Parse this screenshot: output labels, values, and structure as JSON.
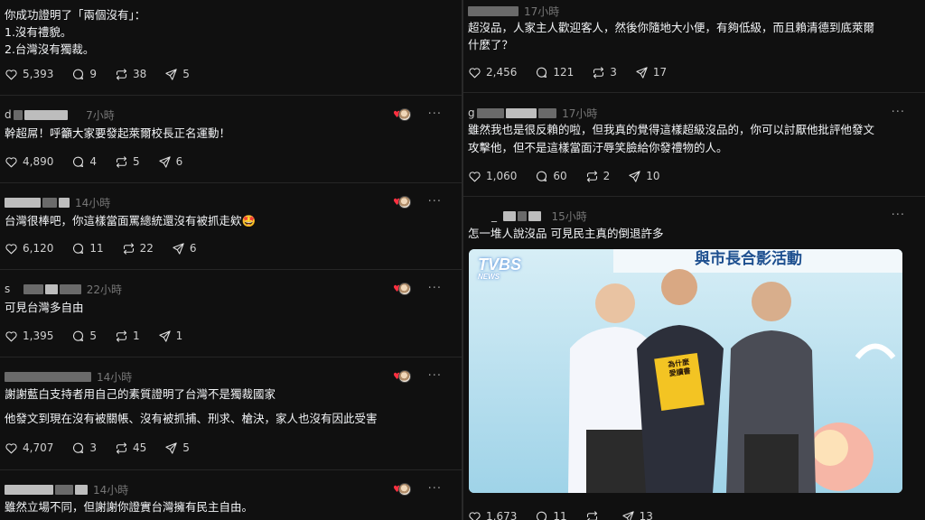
{
  "colors": {
    "background": "#101010",
    "text": "#f3f5f7",
    "muted": "#777777",
    "heart": "#ff3040"
  },
  "left_posts": [
    {
      "lines": [
        "你成功證明了「兩個沒有」：",
        "1.沒有禮貌。",
        "2.台灣沒有獨裁。"
      ],
      "likes": "5,393",
      "replies": "9",
      "reposts": "38",
      "shares": "5"
    },
    {
      "user": "d",
      "time": "7小時",
      "lines": [
        "幹超屌！呼籲大家要發起萊爾校長正名運動！"
      ],
      "likes": "4,890",
      "replies": "4",
      "reposts": "5",
      "shares": "6"
    },
    {
      "user": "",
      "time": "14小時",
      "lines": [
        "台灣很棒吧，你這樣當面罵總統還沒有被抓走欸🤩"
      ],
      "likes": "6,120",
      "replies": "11",
      "reposts": "22",
      "shares": "6"
    },
    {
      "user": "s",
      "time": "22小時",
      "lines": [
        "可見台灣多自由"
      ],
      "likes": "1,395",
      "replies": "5",
      "reposts": "1",
      "shares": "1"
    },
    {
      "user": "",
      "time": "14小時",
      "lines": [
        "謝謝藍白支持者用自己的素質證明了台灣不是獨裁國家",
        "他發文到現在沒有被關帳、沒有被抓捕、刑求、槍決，家人也沒有因此受害"
      ],
      "likes": "4,707",
      "replies": "3",
      "reposts": "45",
      "shares": "5"
    },
    {
      "user": "",
      "time": "14小時",
      "lines": [
        "雖然立場不同，但謝謝你證實台灣擁有民主自由。"
      ]
    }
  ],
  "right_posts": [
    {
      "user": "",
      "time": "17小時",
      "lines": [
        "超沒品，人家主人歡迎客人，然後你隨地大小便，有夠低級，而且賴清德到底萊爾",
        "什麼了？"
      ],
      "likes": "2,456",
      "replies": "121",
      "reposts": "3",
      "shares": "17"
    },
    {
      "user": "g",
      "time": "17小時",
      "lines": [
        "雖然我也是很反賴的啦，但我真的覺得這樣超級沒品的，你可以討厭他批評他發文",
        "攻擊他，但不是這樣當面汙辱笑臉給你發禮物的人。"
      ],
      "likes": "1,060",
      "replies": "60",
      "reposts": "2",
      "shares": "10"
    },
    {
      "user": "_",
      "time": "15小時",
      "lines": [
        "怎一堆人說沒品 可見民主真的倒退許多"
      ],
      "likes": "1,673",
      "replies": "11",
      "reposts": "",
      "shares": "13"
    }
  ],
  "photo": {
    "logo_main": "TVBS",
    "logo_sub": "NEWS",
    "banner": "與市長合影活動",
    "book_title_1": "為什麼",
    "book_title_2": "愛讀書"
  },
  "icons": [
    "heart-icon",
    "reply-icon",
    "repost-icon",
    "share-icon",
    "more-icon",
    "avatar-heart-icon"
  ]
}
